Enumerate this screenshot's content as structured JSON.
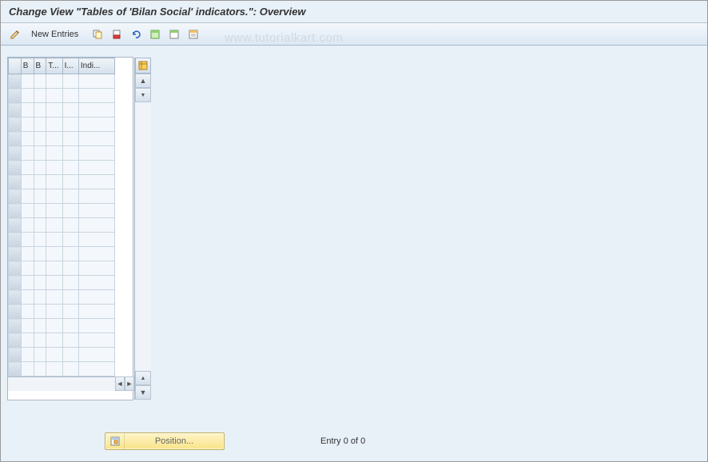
{
  "header": {
    "title": "Change View \"Tables of 'Bilan Social' indicators.\": Overview"
  },
  "toolbar": {
    "new_entries_label": "New Entries"
  },
  "watermark": "www.tutorialkart.com",
  "table": {
    "columns": [
      "B",
      "B",
      "T...",
      "I...",
      "Indi..."
    ],
    "row_count": 21
  },
  "footer": {
    "position_label": "Position...",
    "entry_status": "Entry 0 of 0"
  },
  "icons": {
    "edit": "edit-icon",
    "copy": "copy-icon",
    "delete": "delete-icon",
    "undo": "undo-icon",
    "select_all": "select-all-icon",
    "deselect_all": "deselect-all-icon",
    "print": "print-icon",
    "table_settings": "table-settings-icon"
  }
}
